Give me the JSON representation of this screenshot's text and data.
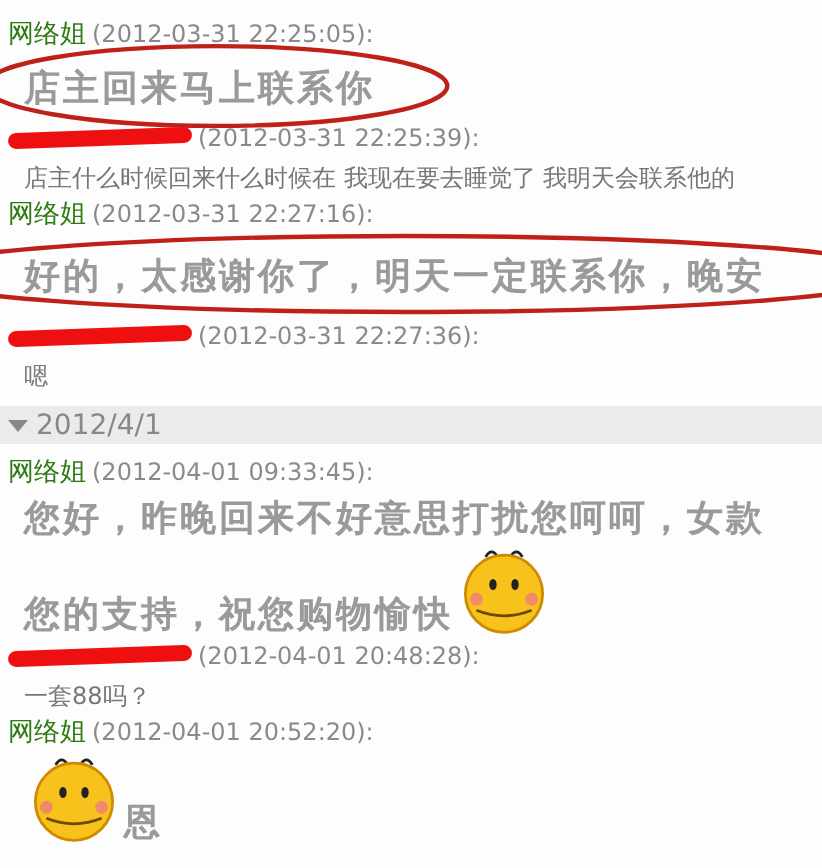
{
  "items": [
    {
      "kind": "message",
      "sender": "网络姐",
      "redacted": false,
      "timestamp": "(2012-03-31 22:25:05):",
      "large": true,
      "circled": true,
      "lines": [
        [
          {
            "kind": "text",
            "text": "店主回来马上联系你"
          }
        ]
      ]
    },
    {
      "kind": "message",
      "redacted": true,
      "timestamp": "(2012-03-31 22:25:39):",
      "large": false,
      "circled": false,
      "lines": [
        [
          {
            "kind": "text",
            "text": "店主什么时候回来什么时候在  我现在要去睡觉了  我明天会联系他的"
          }
        ]
      ]
    },
    {
      "kind": "message",
      "sender": "网络姐",
      "redacted": false,
      "timestamp": "(2012-03-31 22:27:16):",
      "large": true,
      "circled": true,
      "lines": [
        [
          {
            "kind": "text",
            "text": "好的，太感谢你了，明天一定联系你，晚安"
          }
        ]
      ]
    },
    {
      "kind": "message",
      "redacted": true,
      "timestamp": "(2012-03-31 22:27:36):",
      "large": false,
      "circled": false,
      "lines": [
        [
          {
            "kind": "text",
            "text": "嗯"
          }
        ]
      ]
    },
    {
      "kind": "date",
      "label": "2012/4/1",
      "expanded": true
    },
    {
      "kind": "message",
      "sender": "网络姐",
      "redacted": false,
      "timestamp": "(2012-04-01 09:33:45):",
      "large": true,
      "circled": false,
      "lines": [
        [
          {
            "kind": "text",
            "text": "您好，昨晚回来不好意思打扰您呵呵，女款"
          }
        ],
        [
          {
            "kind": "text",
            "text": "您的支持，祝您购物愉快"
          },
          {
            "kind": "emoji"
          }
        ]
      ]
    },
    {
      "kind": "message",
      "redacted": true,
      "timestamp": "(2012-04-01 20:48:28):",
      "large": false,
      "circled": false,
      "lines": [
        [
          {
            "kind": "text",
            "text": "一套88吗？"
          }
        ]
      ]
    },
    {
      "kind": "message",
      "sender": "网络姐",
      "redacted": false,
      "timestamp": "(2012-04-01 20:52:20):",
      "large": true,
      "circled": false,
      "lines": [
        [
          {
            "kind": "emoji"
          },
          {
            "kind": "text",
            "text": "恩"
          }
        ]
      ]
    }
  ]
}
